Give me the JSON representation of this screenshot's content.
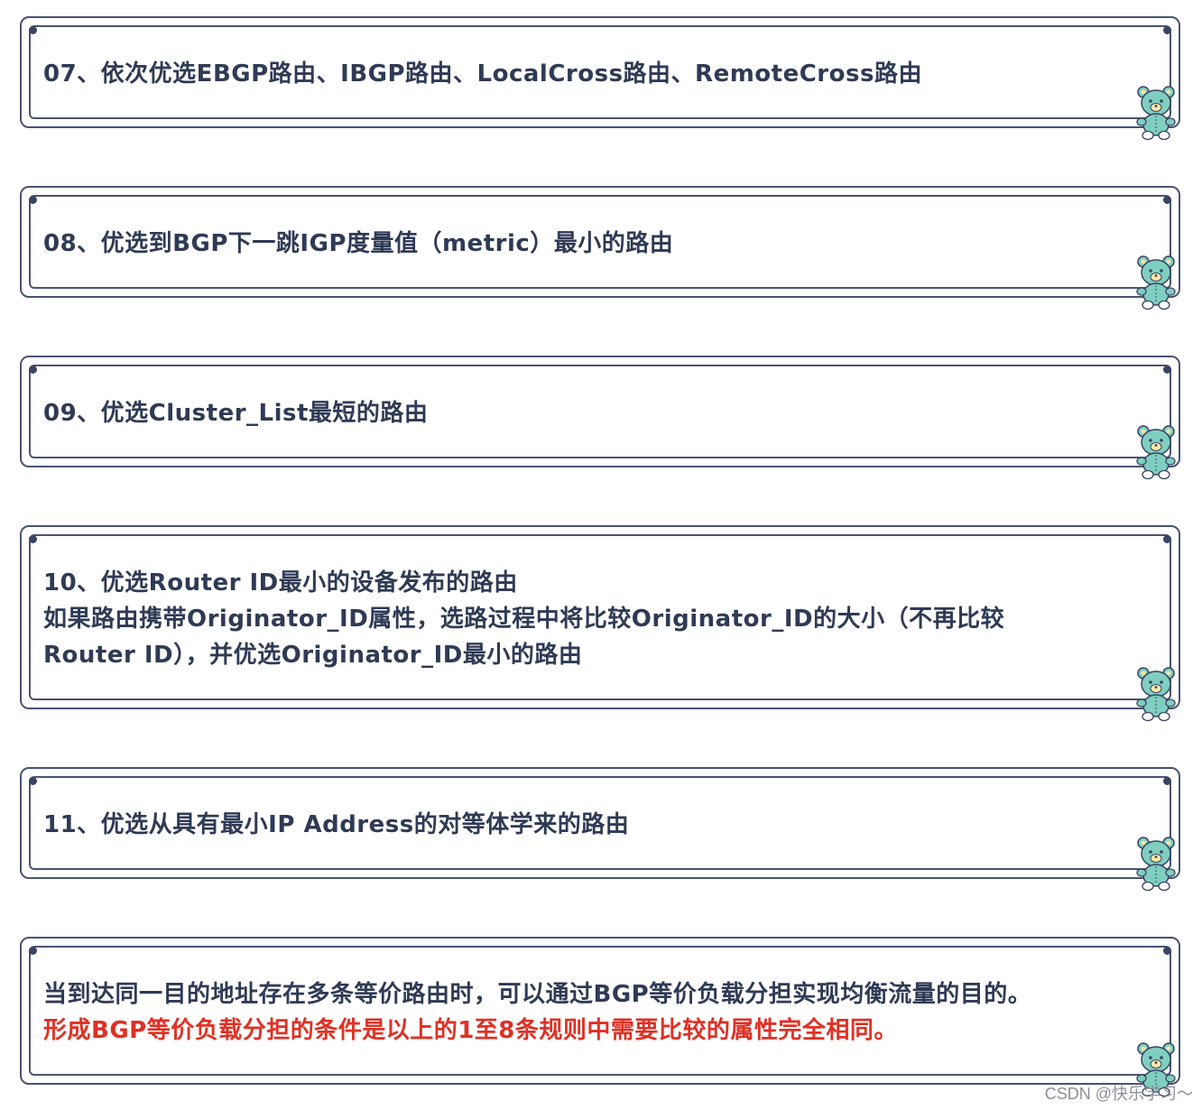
{
  "cards": [
    {
      "lines": [
        "07、依次优选EBGP路由、IBGP路由、LocalCross路由、RemoteCross路由"
      ]
    },
    {
      "lines": [
        "08、优选到BGP下一跳IGP度量值（metric）最小的路由"
      ]
    },
    {
      "lines": [
        "09、优选Cluster_List最短的路由"
      ]
    },
    {
      "lines": [
        "10、优选Router ID最小的设备发布的路由",
        "如果路由携带Originator_ID属性，选路过程中将比较Originator_ID的大小（不再比较",
        "Router ID），并优选Originator_ID最小的路由"
      ]
    },
    {
      "lines": [
        "11、优选从具有最小IP Address的对等体学来的路由"
      ]
    },
    {
      "lines": [
        "当到达同一目的地址存在多条等价路由时，可以通过BGP等价负载分担实现均衡流量的目的。",
        "形成BGP等价负载分担的条件是以上的1至8条规则中需要比较的属性完全相同。"
      ]
    }
  ],
  "icons": {
    "decoration": "teddy-bear-icon"
  },
  "colors": {
    "text": "#2f3a55",
    "highlight": "#e03024",
    "border": "#4a5470",
    "bear": "#7fcfc0"
  },
  "footer": {
    "watermark": "CSDN @快乐学习～"
  }
}
